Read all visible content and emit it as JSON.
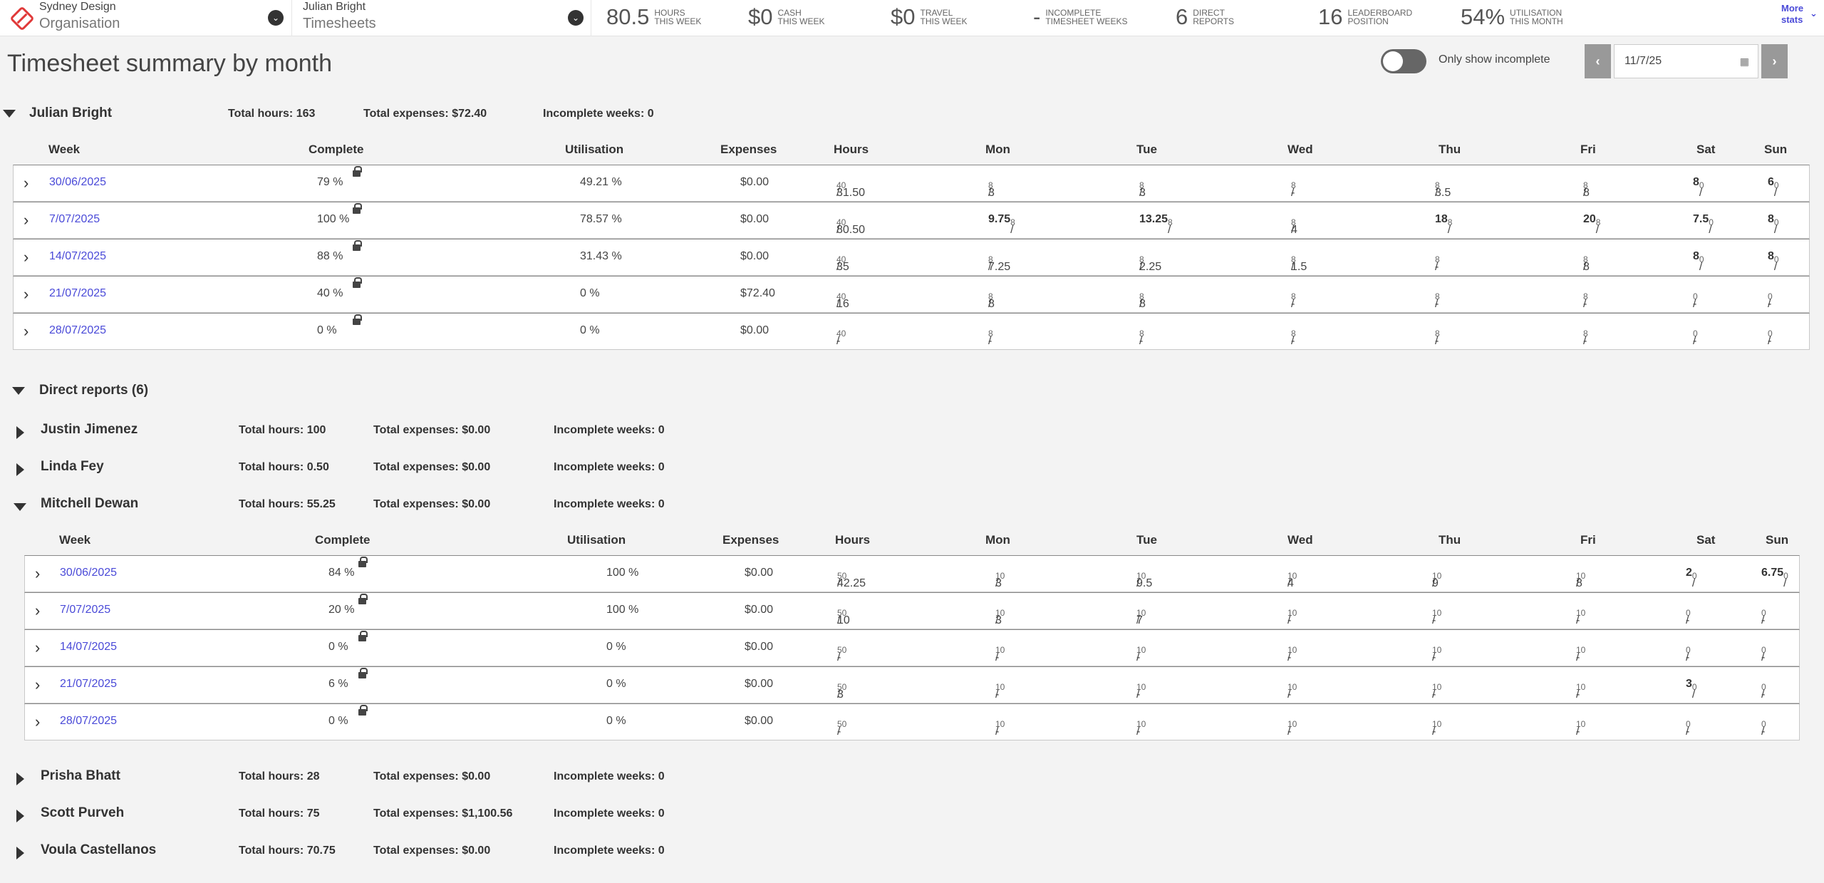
{
  "topbar": {
    "org_small": "Sydney Design",
    "org_big": "Organisation",
    "ts_small": "Julian Bright",
    "ts_big": "Timesheets",
    "stats": [
      {
        "num": "80.5",
        "l1": "HOURS",
        "l2": "THIS WEEK"
      },
      {
        "num": "$0",
        "l1": "CASH",
        "l2": "THIS WEEK"
      },
      {
        "num": "$0",
        "l1": "TRAVEL",
        "l2": "THIS WEEK"
      },
      {
        "num": "-",
        "l1": "INCOMPLETE",
        "l2": "TIMESHEET WEEKS"
      },
      {
        "num": "6",
        "l1": "DIRECT",
        "l2": "REPORTS"
      },
      {
        "num": "16",
        "l1": "LEADERBOARD",
        "l2": "POSITION"
      },
      {
        "num": "54%",
        "l1": "UTILISATION",
        "l2": "THIS MONTH"
      }
    ],
    "more_stats_1": "More",
    "more_stats_2": "stats",
    "accent": "#4a4ad8",
    "logo_color": "#e03a3a"
  },
  "header": {
    "title": "Timesheet summary by month",
    "toggle_label": "Only show incomplete",
    "date_value": "11/7/25"
  },
  "columns": [
    "Week",
    "Complete",
    "Utilisation",
    "Expenses",
    "Hours",
    "Mon",
    "Tue",
    "Wed",
    "Thu",
    "Fri",
    "Sat",
    "Sun"
  ],
  "julian": {
    "name": "Julian Bright",
    "total_hours": "Total hours: 163",
    "total_expenses": "Total expenses: $72.40",
    "incomplete": "Incomplete weeks: 0",
    "rows": [
      {
        "week": "30/06/2025",
        "complete": "79 %",
        "util": "49.21 %",
        "exp": "$0.00",
        "hours": [
          "31.50",
          "40",
          false
        ],
        "days": [
          [
            "3",
            "8",
            false
          ],
          [
            "3",
            "8",
            false
          ],
          [
            "-",
            "8",
            false
          ],
          [
            "3.5",
            "8",
            false
          ],
          [
            "8",
            "8",
            false
          ],
          [
            "8",
            "0",
            true
          ],
          [
            "6",
            "0",
            true
          ]
        ]
      },
      {
        "week": "7/07/2025",
        "complete": "100 %",
        "util": "78.57 %",
        "exp": "$0.00",
        "hours": [
          "80.50",
          "40",
          false
        ],
        "days": [
          [
            "9.75",
            "8",
            true
          ],
          [
            "13.25",
            "8",
            true
          ],
          [
            "4",
            "8",
            false
          ],
          [
            "18",
            "8",
            true
          ],
          [
            "20",
            "8",
            true
          ],
          [
            "7.5",
            "0",
            true
          ],
          [
            "8",
            "0",
            true
          ]
        ]
      },
      {
        "week": "14/07/2025",
        "complete": "88 %",
        "util": "31.43 %",
        "exp": "$0.00",
        "hours": [
          "35",
          "40",
          false
        ],
        "days": [
          [
            "7.25",
            "8",
            false
          ],
          [
            "2.25",
            "8",
            false
          ],
          [
            "1.5",
            "8",
            false
          ],
          [
            "-",
            "8",
            false
          ],
          [
            "8",
            "8",
            false
          ],
          [
            "8",
            "0",
            true
          ],
          [
            "8",
            "0",
            true
          ]
        ]
      },
      {
        "week": "21/07/2025",
        "complete": "40 %",
        "util": "0 %",
        "exp": "$72.40",
        "hours": [
          "16",
          "40",
          false
        ],
        "days": [
          [
            "8",
            "8",
            false
          ],
          [
            "8",
            "8",
            false
          ],
          [
            "-",
            "8",
            false
          ],
          [
            "-",
            "8",
            false
          ],
          [
            "-",
            "8",
            false
          ],
          [
            "-",
            "0",
            false
          ],
          [
            "-",
            "0",
            false
          ]
        ]
      },
      {
        "week": "28/07/2025",
        "complete": "0 %",
        "util": "0 %",
        "exp": "$0.00",
        "hours": [
          "-",
          "40",
          false
        ],
        "days": [
          [
            "-",
            "8",
            false
          ],
          [
            "-",
            "8",
            false
          ],
          [
            "-",
            "8",
            false
          ],
          [
            "-",
            "8",
            false
          ],
          [
            "-",
            "8",
            false
          ],
          [
            "-",
            "0",
            false
          ],
          [
            "-",
            "0",
            false
          ]
        ]
      }
    ]
  },
  "direct_reports_label": "Direct reports (6)",
  "reports": [
    {
      "name": "Justin Jimenez",
      "total_hours": "Total hours: 100",
      "total_expenses": "Total expenses: $0.00",
      "incomplete": "Incomplete weeks: 0"
    },
    {
      "name": "Linda Fey",
      "total_hours": "Total hours: 0.50",
      "total_expenses": "Total expenses: $0.00",
      "incomplete": "Incomplete weeks: 0"
    },
    {
      "name": "Mitchell Dewan",
      "total_hours": "Total hours: 55.25",
      "total_expenses": "Total expenses: $0.00",
      "incomplete": "Incomplete weeks: 0"
    },
    {
      "name": "Prisha Bhatt",
      "total_hours": "Total hours: 28",
      "total_expenses": "Total expenses: $0.00",
      "incomplete": "Incomplete weeks: 0"
    },
    {
      "name": "Scott Purveh",
      "total_hours": "Total hours: 75",
      "total_expenses": "Total expenses: $1,100.56",
      "incomplete": "Incomplete weeks: 0"
    },
    {
      "name": "Voula Castellanos",
      "total_hours": "Total hours: 70.75",
      "total_expenses": "Total expenses: $0.00",
      "incomplete": "Incomplete weeks: 0"
    }
  ],
  "mitchell_rows": [
    {
      "week": "30/06/2025",
      "complete": "84 %",
      "util": "100 %",
      "exp": "$0.00",
      "hours": [
        "42.25",
        "50",
        false
      ],
      "days": [
        [
          "3",
          "10",
          false
        ],
        [
          "9.5",
          "10",
          false
        ],
        [
          "4",
          "10",
          false
        ],
        [
          "9",
          "10",
          false
        ],
        [
          "8",
          "10",
          false
        ],
        [
          "2",
          "0",
          true
        ],
        [
          "6.75",
          "0",
          true
        ]
      ]
    },
    {
      "week": "7/07/2025",
      "complete": "20 %",
      "util": "100 %",
      "exp": "$0.00",
      "hours": [
        "10",
        "50",
        false
      ],
      "days": [
        [
          "3",
          "10",
          false
        ],
        [
          "7",
          "10",
          false
        ],
        [
          "-",
          "10",
          false
        ],
        [
          "-",
          "10",
          false
        ],
        [
          "-",
          "10",
          false
        ],
        [
          "-",
          "0",
          false
        ],
        [
          "-",
          "0",
          false
        ]
      ]
    },
    {
      "week": "14/07/2025",
      "complete": "0 %",
      "util": "0 %",
      "exp": "$0.00",
      "hours": [
        "-",
        "50",
        false
      ],
      "days": [
        [
          "-",
          "10",
          false
        ],
        [
          "-",
          "10",
          false
        ],
        [
          "-",
          "10",
          false
        ],
        [
          "-",
          "10",
          false
        ],
        [
          "-",
          "10",
          false
        ],
        [
          "-",
          "0",
          false
        ],
        [
          "-",
          "0",
          false
        ]
      ]
    },
    {
      "week": "21/07/2025",
      "complete": "6 %",
      "util": "0 %",
      "exp": "$0.00",
      "hours": [
        "3",
        "50",
        false
      ],
      "days": [
        [
          "-",
          "10",
          false
        ],
        [
          "-",
          "10",
          false
        ],
        [
          "-",
          "10",
          false
        ],
        [
          "-",
          "10",
          false
        ],
        [
          "-",
          "10",
          false
        ],
        [
          "3",
          "0",
          true
        ],
        [
          "-",
          "0",
          false
        ]
      ]
    },
    {
      "week": "28/07/2025",
      "complete": "0 %",
      "util": "0 %",
      "exp": "$0.00",
      "hours": [
        "-",
        "50",
        false
      ],
      "days": [
        [
          "-",
          "10",
          false
        ],
        [
          "-",
          "10",
          false
        ],
        [
          "-",
          "10",
          false
        ],
        [
          "-",
          "10",
          false
        ],
        [
          "-",
          "10",
          false
        ],
        [
          "-",
          "0",
          false
        ],
        [
          "-",
          "0",
          false
        ]
      ]
    }
  ]
}
